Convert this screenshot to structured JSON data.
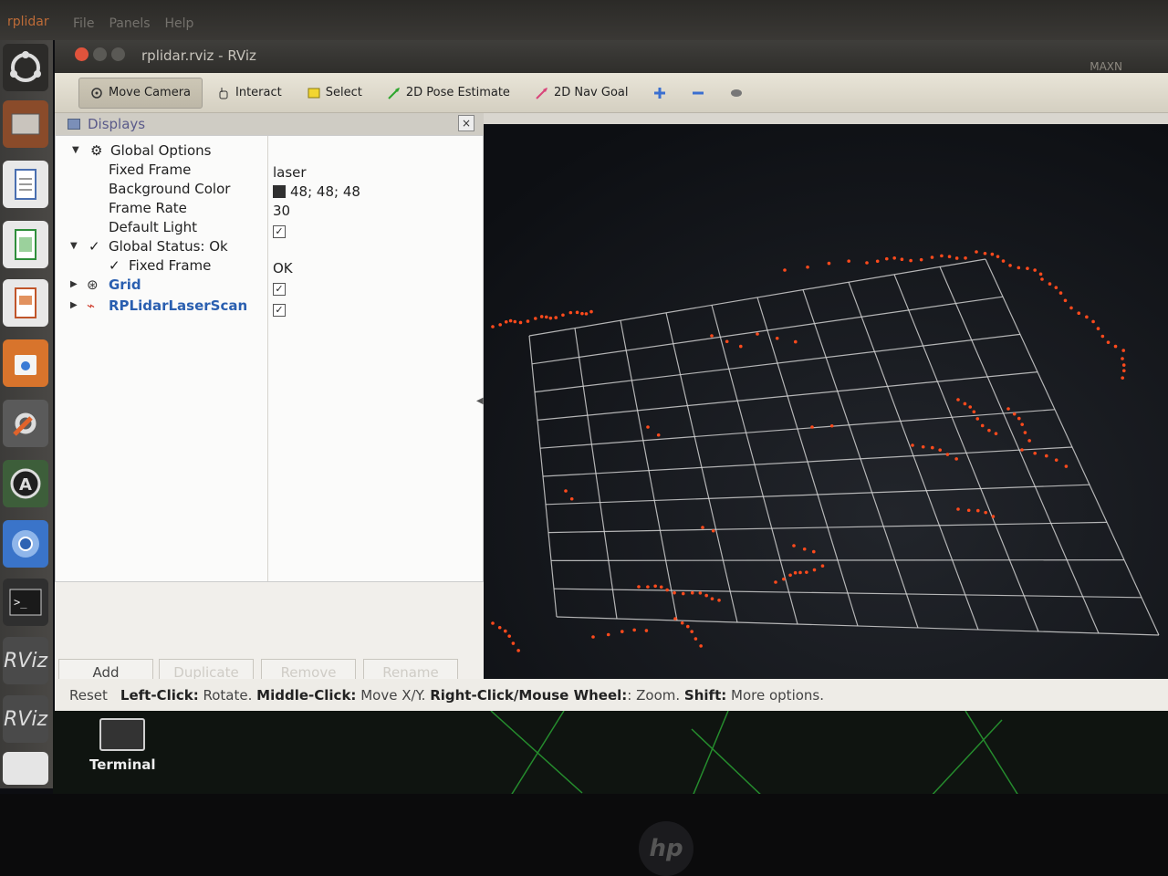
{
  "menubar": {
    "app": "rplidar",
    "menus": [
      "File",
      "Panels",
      "Help"
    ]
  },
  "window": {
    "title": "rplidar.rviz - RViz",
    "right_text": "MAXN"
  },
  "toolbar": {
    "tools": [
      {
        "label": "Move Camera",
        "icon": "move-camera-icon"
      },
      {
        "label": "Interact",
        "icon": "hand-icon"
      },
      {
        "label": "Select",
        "icon": "select-icon"
      },
      {
        "label": "2D Pose Estimate",
        "icon": "green-arrow-icon"
      },
      {
        "label": "2D Nav Goal",
        "icon": "pink-arrow-icon"
      }
    ],
    "extra_icons": [
      "plus-icon",
      "minus-icon",
      "camera-icon"
    ]
  },
  "displays": {
    "title": "Displays",
    "close": "×",
    "rows": [
      {
        "label": "Global Options",
        "value": ""
      },
      {
        "label": "Fixed Frame",
        "value": "laser"
      },
      {
        "label": "Background Color",
        "value": "48; 48; 48"
      },
      {
        "label": "Frame Rate",
        "value": "30"
      },
      {
        "label": "Default Light",
        "value": "✓"
      },
      {
        "label": "Global Status: Ok",
        "value": ""
      },
      {
        "label": "Fixed Frame",
        "value": "OK"
      },
      {
        "label": "Grid",
        "value": "✓"
      },
      {
        "label": "RPLidarLaserScan",
        "value": "✓"
      }
    ],
    "buttons": {
      "add": "Add",
      "duplicate": "Duplicate",
      "remove": "Remove",
      "rename": "Rename"
    }
  },
  "statusbar": {
    "reset": "Reset",
    "left_click": "Left-Click:",
    "left_click_desc": "Rotate.",
    "middle_click": "Middle-Click:",
    "middle_click_desc": "Move X/Y.",
    "right_click": "Right-Click/Mouse Wheel:",
    "right_click_desc": ": Zoom.",
    "shift": "Shift:",
    "shift_desc": "More options."
  },
  "desktop": {
    "terminal_label": "Terminal"
  },
  "launcher": [
    "ubuntu-icon",
    "files-icon",
    "writer-icon",
    "calc-icon",
    "impress-icon",
    "store-icon",
    "settings-icon",
    "updater-icon",
    "chromium-icon",
    "terminal-icon",
    "rviz-icon",
    "rviz-icon",
    "drive-icon"
  ],
  "colors": {
    "background_color": "#303030",
    "scan_color": "#ff4a1c",
    "grid_color": "#d0d0d0"
  }
}
